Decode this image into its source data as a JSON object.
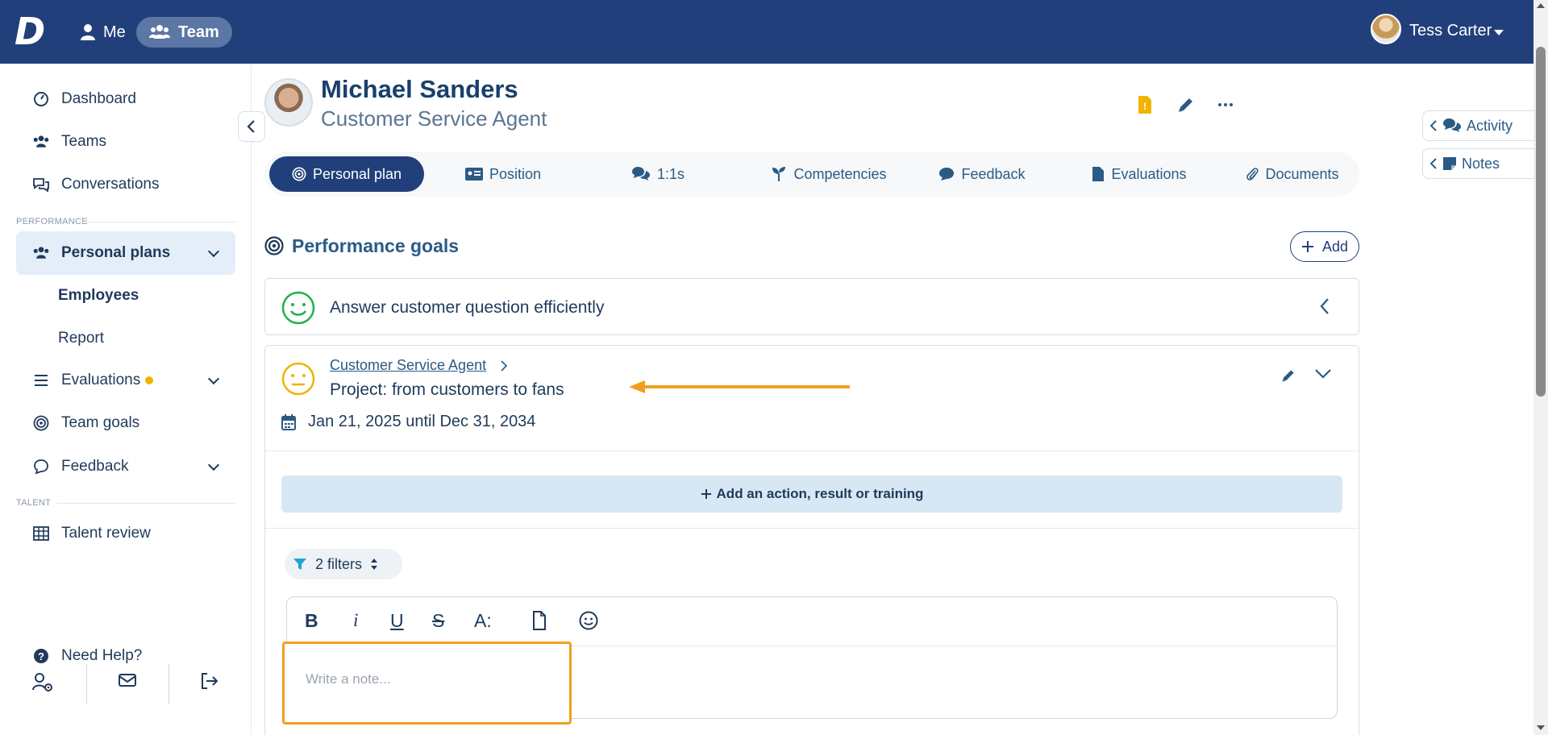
{
  "topbar": {
    "logo": "D",
    "nav": [
      {
        "label": "Me"
      },
      {
        "label": "Team"
      }
    ],
    "user_name": "Tess Carter"
  },
  "sidebar": {
    "items": [
      {
        "label": "Dashboard",
        "icon": "dashboard-icon"
      },
      {
        "label": "Teams",
        "icon": "users-icon"
      },
      {
        "label": "Conversations",
        "icon": "chat-icon"
      }
    ],
    "section_performance": "PERFORMANCE",
    "personal_plans": "Personal plans",
    "sub_items": [
      "Employees",
      "Report"
    ],
    "evaluations": "Evaluations",
    "team_goals": "Team goals",
    "feedback": "Feedback",
    "section_talent": "TALENT",
    "talent_review": "Talent review",
    "need_help": "Need Help?"
  },
  "profile": {
    "name": "Michael Sanders",
    "role": "Customer Service Agent"
  },
  "tabs": [
    {
      "label": "Personal plan",
      "icon": "target-icon",
      "active": true
    },
    {
      "label": "Position",
      "icon": "id-card-icon"
    },
    {
      "label": "1:1s",
      "icon": "chat-bubbles-icon"
    },
    {
      "label": "Competencies",
      "icon": "seedling-icon"
    },
    {
      "label": "Feedback",
      "icon": "comment-icon"
    },
    {
      "label": "Evaluations",
      "icon": "file-icon"
    },
    {
      "label": "Documents",
      "icon": "paperclip-icon"
    }
  ],
  "right_panel": {
    "activity": "Activity",
    "notes": "Notes"
  },
  "goals": {
    "title": "Performance goals",
    "add_label": "Add",
    "goal1": {
      "title": "Answer customer question efficiently",
      "status_color": "#22b04b"
    },
    "goal2": {
      "breadcrumb": "Customer Service Agent",
      "title": "Project: from customers to fans",
      "dates": "Jan 21, 2025 until Dec 31, 2034",
      "status_color": "#f0b400"
    },
    "action_label": "Add an action, result or training",
    "filters_label": "2 filters",
    "toolbar": [
      "B",
      "i",
      "U",
      "S",
      "A:"
    ],
    "note_placeholder": "Write a note..."
  },
  "colors": {
    "primary": "#213f7a",
    "accent": "#f0a020"
  }
}
